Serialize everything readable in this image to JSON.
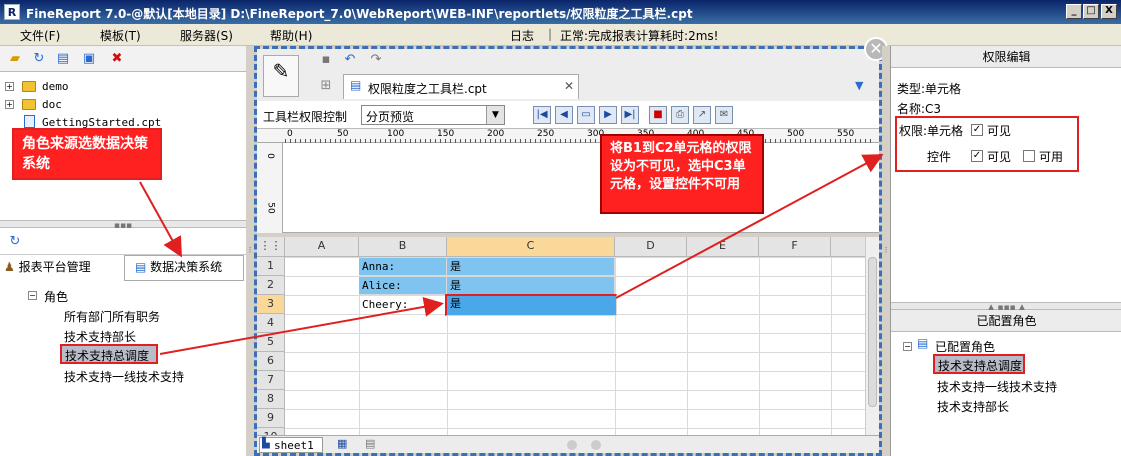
{
  "window": {
    "title": "FineReport 7.0-@默认[本地目录]    D:\\FineReport_7.0\\WebReport\\WEB-INF\\reportlets/权限粒度之工具栏.cpt",
    "logo": "R",
    "min": "_",
    "max": "□",
    "close": "X"
  },
  "menu": {
    "file": "文件(F)",
    "template": "模板(T)",
    "server": "服务器(S)",
    "help": "帮助(H)",
    "log": "日志",
    "status": "正常:完成报表计算耗时:2ms!"
  },
  "filetree": {
    "items": [
      "demo",
      "doc",
      "GettingStarted.cpt"
    ]
  },
  "left_callout": "角色来源选数据决策系统",
  "role_tabs": {
    "tab1": "报表平台管理",
    "tab2": "数据决策系统"
  },
  "role_tree": {
    "root": "角色",
    "items": [
      "所有部门所有职务",
      "技术支持部长",
      "技术支持总调度",
      "技术支持一线技术支持"
    ]
  },
  "editor": {
    "tab_label": "权限粒度之工具栏.cpt",
    "toolbar_label": "工具栏权限控制",
    "preview_select": "分页预览",
    "ruler_h": [
      "0",
      "50",
      "100",
      "150",
      "200",
      "250",
      "300",
      "350",
      "400",
      "450",
      "500",
      "550"
    ],
    "ruler_v": [
      "0",
      "50"
    ],
    "columns": [
      "A",
      "B",
      "C",
      "D",
      "E",
      "F"
    ],
    "rows": [
      "1",
      "2",
      "3",
      "4",
      "5",
      "6",
      "7",
      "8",
      "9",
      "10"
    ],
    "cells": {
      "b1": "Anna:",
      "c1": "是",
      "b2": "Alice:",
      "c2": "是",
      "b3": "Cheery:",
      "c3": "是"
    },
    "sheet": "sheet1"
  },
  "center_callout": "将B1到C2单元格的权限设为不可见，选中C3单元格，设置控件不可用",
  "perm": {
    "header": "权限编辑",
    "type": "类型:单元格",
    "name": "名称:C3",
    "perm_label": "权限:单元格",
    "visible": "可见",
    "control": "控件",
    "control_visible": "可见",
    "control_enabled": "可用"
  },
  "configured": {
    "header": "已配置角色",
    "root": "已配置角色",
    "items": [
      "技术支持总调度",
      "技术支持一线技术支持",
      "技术支持部长"
    ]
  },
  "colors": {
    "accent": "#3b6fb6",
    "highlight_red": "#e02020",
    "selected_cell": "#7fc4f0"
  }
}
